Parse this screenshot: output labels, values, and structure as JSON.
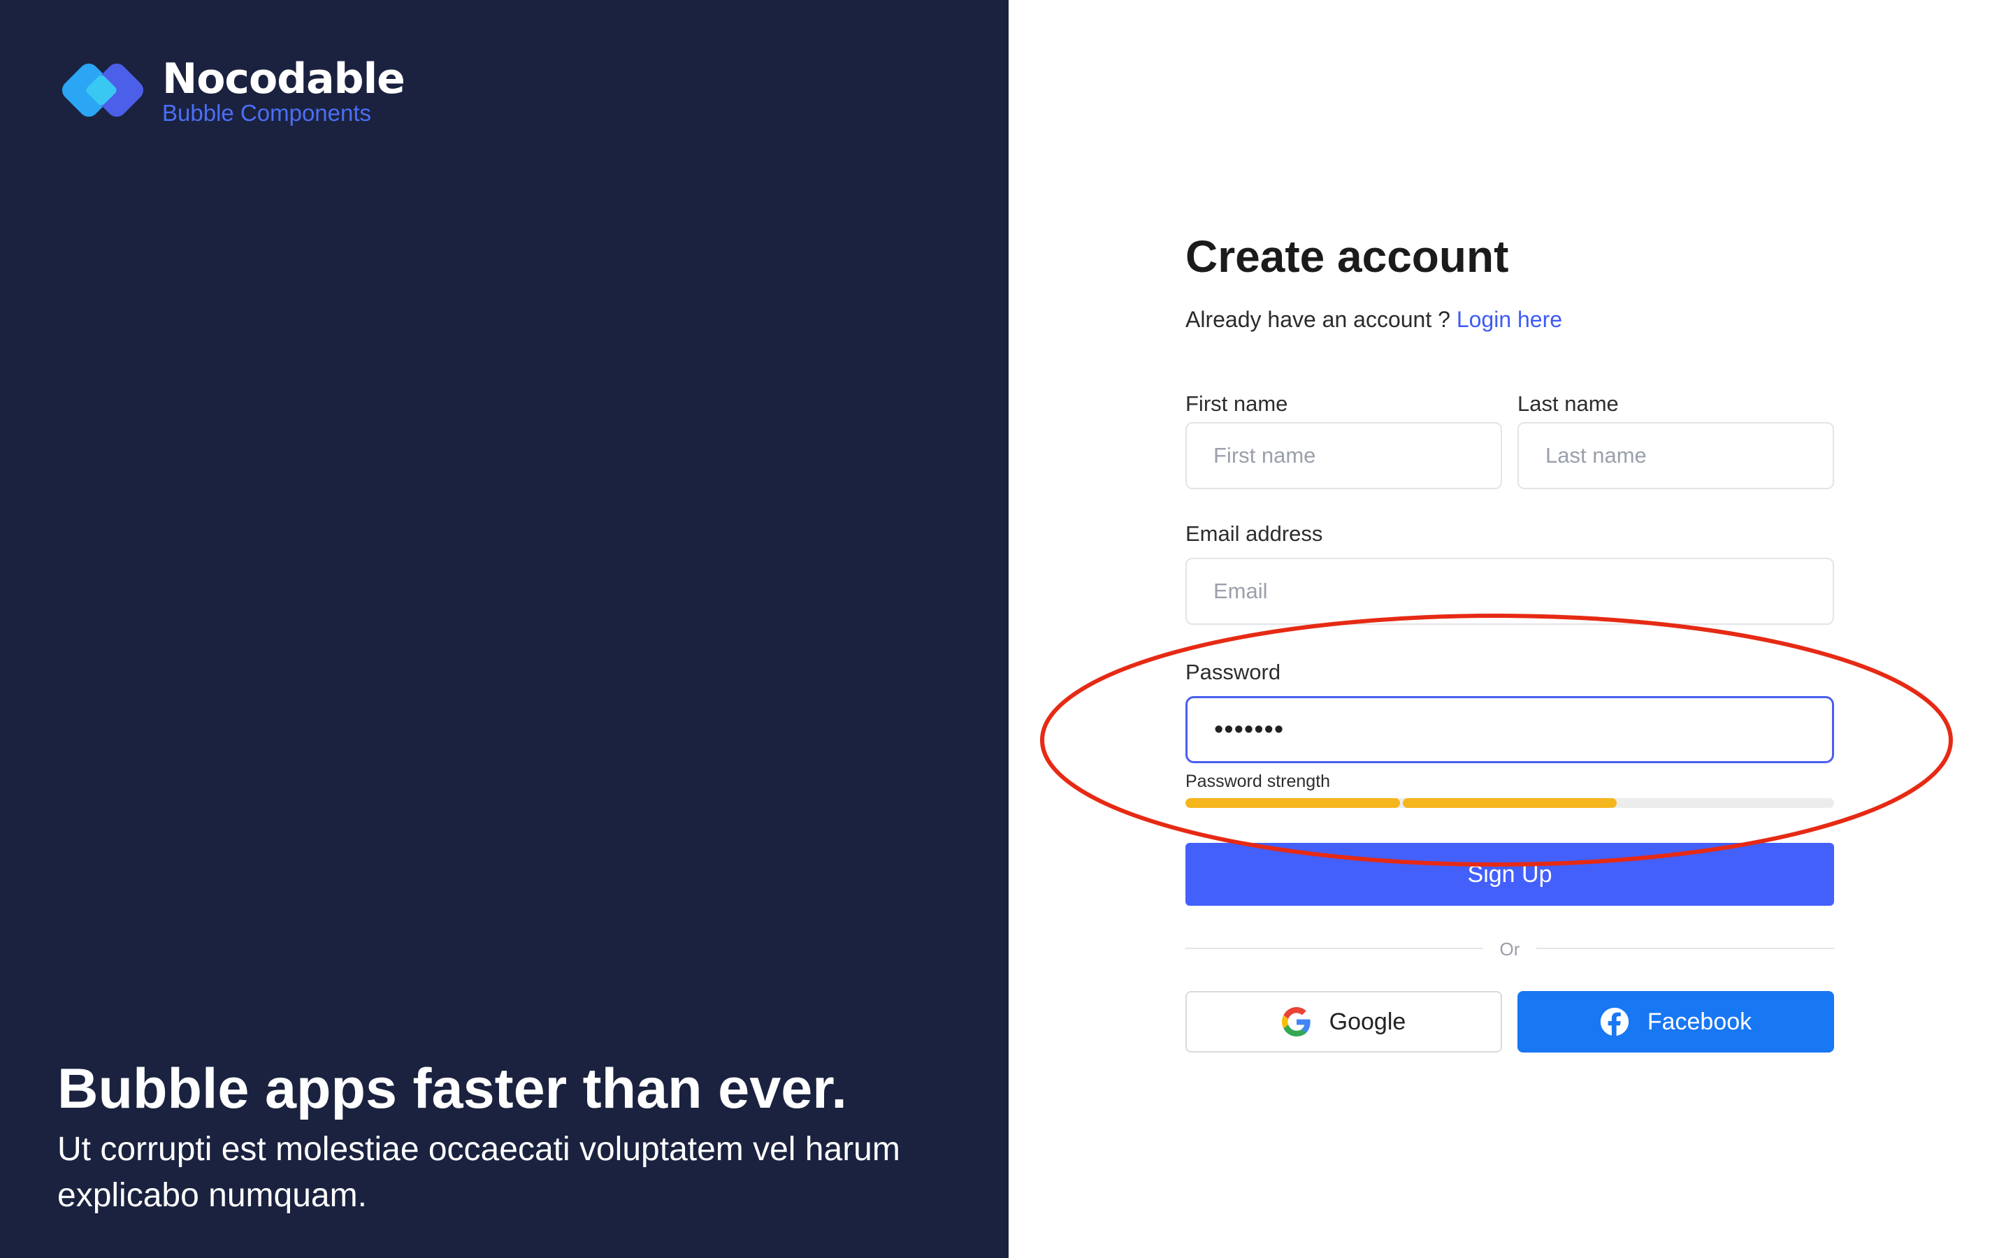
{
  "brand": {
    "name": "Nocodable",
    "subtitle": "Bubble Components"
  },
  "hero": {
    "headline": "Bubble apps faster than ever.",
    "tagline": "Ut corrupti est molestiae occaecati voluptatem vel harum explicabo numquam."
  },
  "form": {
    "title": "Create account",
    "login_prompt": "Already have an account ?",
    "login_link": "Login here",
    "first_name": {
      "label": "First name",
      "placeholder": "First name"
    },
    "last_name": {
      "label": "Last name",
      "placeholder": "Last name"
    },
    "email": {
      "label": "Email address",
      "placeholder": "Email"
    },
    "password": {
      "label": "Password",
      "value": "•••••••"
    },
    "strength": {
      "label": "Password strength",
      "filled_segments": 2,
      "total_segments": 3
    },
    "signup_label": "Sign Up",
    "or_label": "Or",
    "google_label": "Google",
    "facebook_label": "Facebook"
  },
  "colors": {
    "panel": "#1a223f",
    "accent": "#4460fb",
    "strength_fill": "#f5b51c",
    "facebook": "#1877f2",
    "annotation": "#e62a14"
  }
}
